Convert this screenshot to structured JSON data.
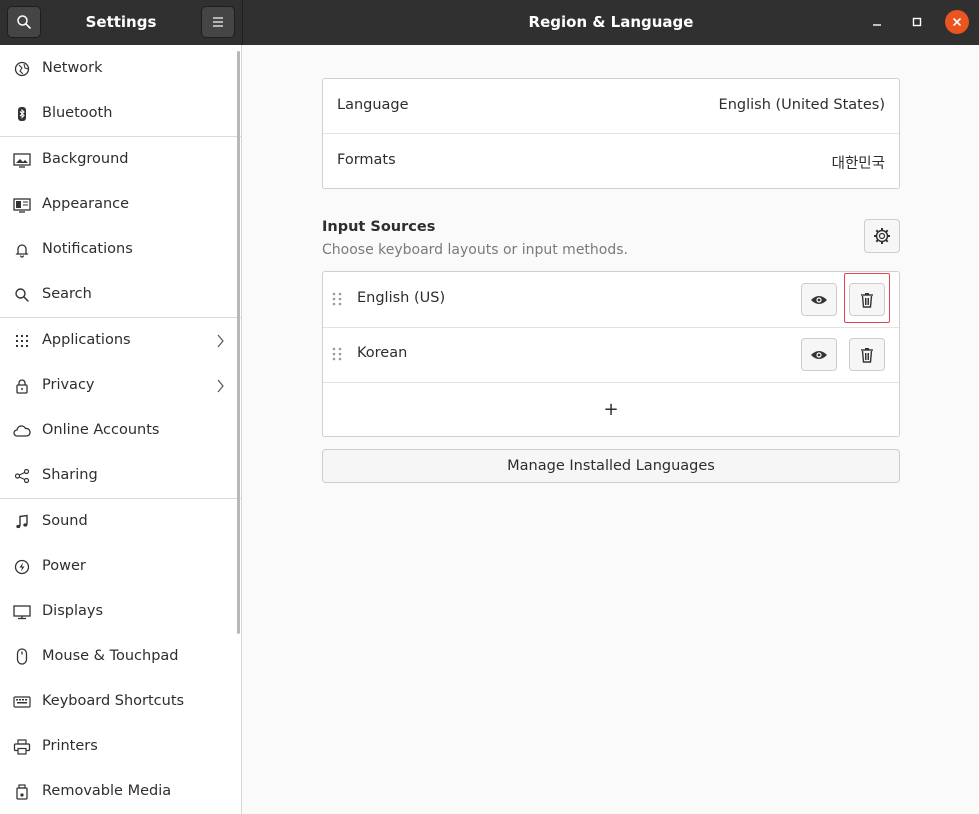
{
  "window": {
    "sidebar_title": "Settings",
    "title": "Region & Language"
  },
  "sidebar": {
    "items": [
      {
        "label": "Network",
        "icon": "network-icon"
      },
      {
        "label": "Bluetooth",
        "icon": "bluetooth-icon"
      },
      {
        "label": "Background",
        "icon": "background-icon"
      },
      {
        "label": "Appearance",
        "icon": "appearance-icon"
      },
      {
        "label": "Notifications",
        "icon": "bell-icon"
      },
      {
        "label": "Search",
        "icon": "search-icon"
      },
      {
        "label": "Applications",
        "icon": "apps-grid-icon"
      },
      {
        "label": "Privacy",
        "icon": "lock-icon"
      },
      {
        "label": "Online Accounts",
        "icon": "cloud-icon"
      },
      {
        "label": "Sharing",
        "icon": "share-icon"
      },
      {
        "label": "Sound",
        "icon": "music-note-icon"
      },
      {
        "label": "Power",
        "icon": "power-icon"
      },
      {
        "label": "Displays",
        "icon": "display-icon"
      },
      {
        "label": "Mouse & Touchpad",
        "icon": "mouse-icon"
      },
      {
        "label": "Keyboard Shortcuts",
        "icon": "keyboard-icon"
      },
      {
        "label": "Printers",
        "icon": "printer-icon"
      },
      {
        "label": "Removable Media",
        "icon": "usb-icon"
      }
    ]
  },
  "region": {
    "language_label": "Language",
    "language_value": "English (United States)",
    "formats_label": "Formats",
    "formats_value": "대한민국"
  },
  "input_sources": {
    "title": "Input Sources",
    "subtitle": "Choose keyboard layouts or input methods.",
    "sources": [
      {
        "name": "English (US)"
      },
      {
        "name": "Korean"
      }
    ],
    "add_symbol": "+"
  },
  "manage_button": "Manage Installed Languages",
  "colors": {
    "accent": "#e95420",
    "highlight": "#e0474f",
    "headerbar": "#303030"
  }
}
